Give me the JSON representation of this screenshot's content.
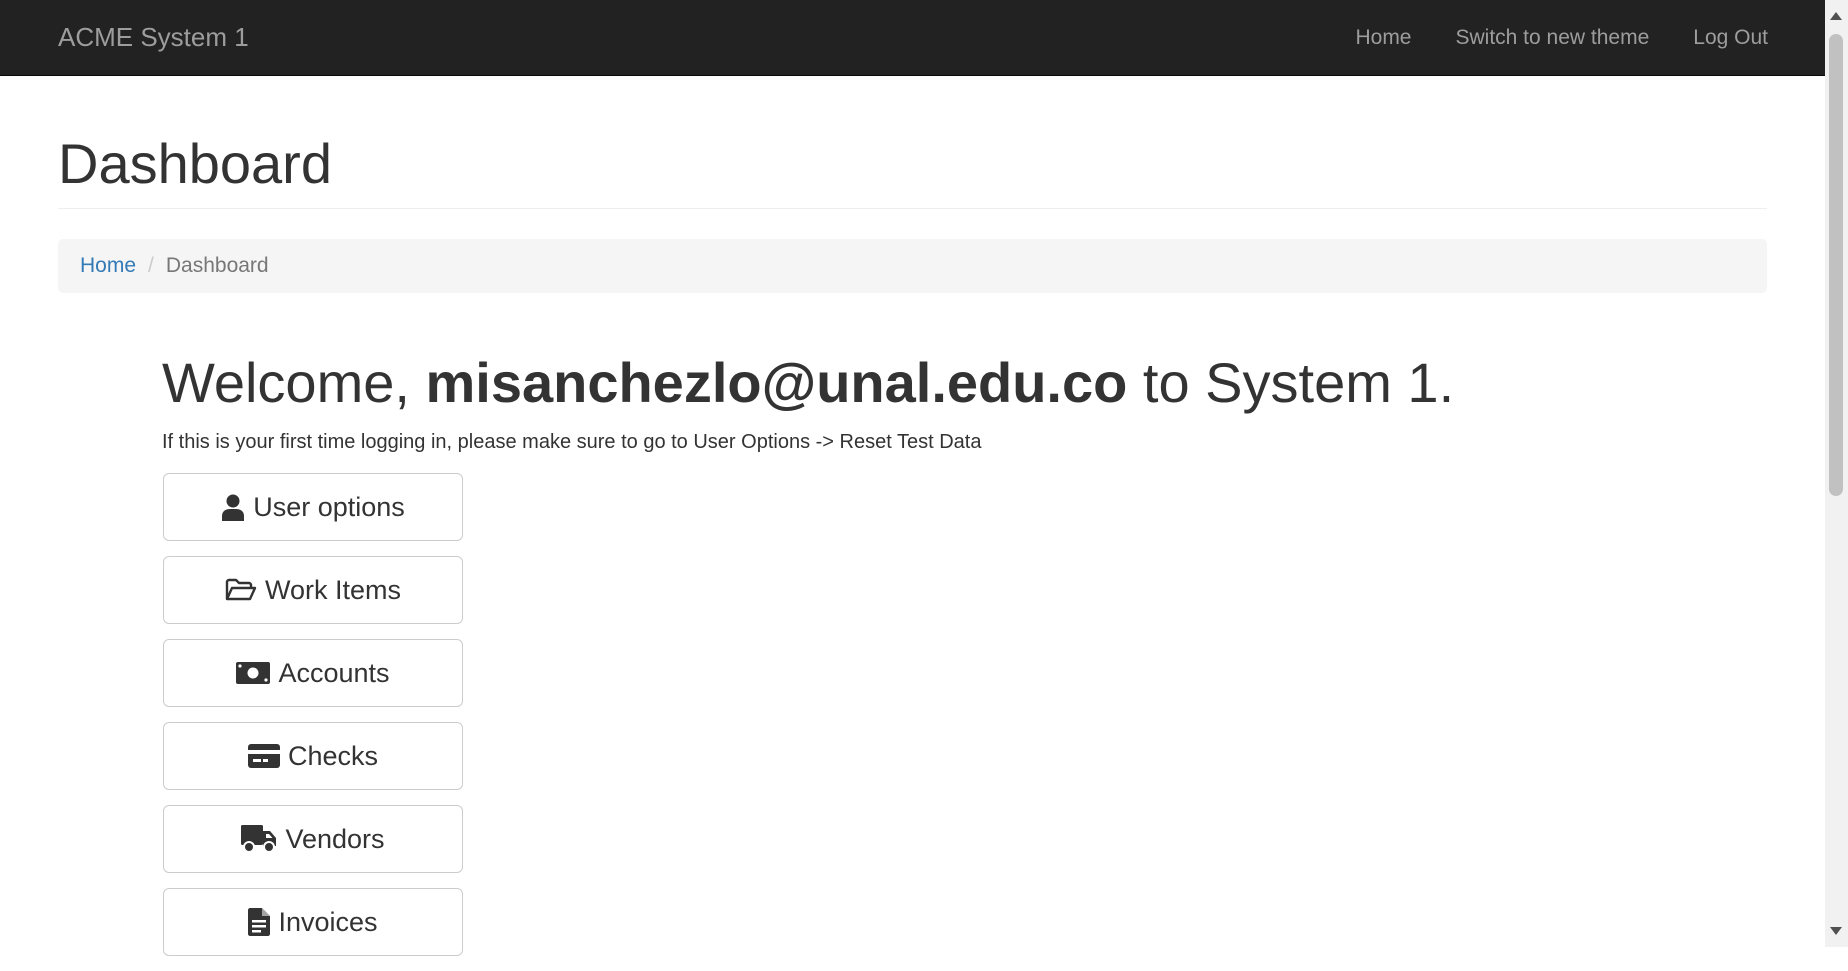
{
  "navbar": {
    "brand": "ACME System 1",
    "links": [
      "Home",
      "Switch to new theme",
      "Log Out"
    ]
  },
  "page": {
    "title": "Dashboard"
  },
  "breadcrumb": {
    "home": "Home",
    "current": "Dashboard"
  },
  "welcome": {
    "prefix": "Welcome, ",
    "user": "misanchezlo@unal.edu.co",
    "suffix": " to System 1.",
    "hint": "If this is your first time logging in, please make sure to go to User Options -> Reset Test Data"
  },
  "menu": [
    {
      "label": "User options",
      "icon": "user-icon"
    },
    {
      "label": "Work Items",
      "icon": "folder-open-icon"
    },
    {
      "label": "Accounts",
      "icon": "money-bill-icon"
    },
    {
      "label": "Checks",
      "icon": "credit-card-icon"
    },
    {
      "label": "Vendors",
      "icon": "truck-icon"
    },
    {
      "label": "Invoices",
      "icon": "file-invoice-icon"
    }
  ],
  "colors": {
    "navbar_bg": "#222222",
    "navbar_text": "#9d9d9d",
    "link": "#337ab7",
    "breadcrumb_bg": "#f5f5f5"
  }
}
